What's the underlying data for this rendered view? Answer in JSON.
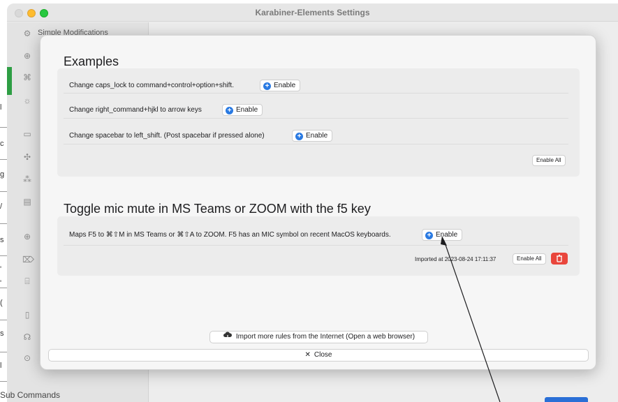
{
  "window": {
    "title": "Karabiner-Elements Settings"
  },
  "sidebar": {
    "visible_label": "Simple Modifications",
    "icons": [
      "gear-icon",
      "circle-arrow-icon",
      "keys-icon",
      "sun-icon",
      "keyboard-icon",
      "gamepad-icon",
      "devices-icon",
      "card-icon",
      "globe-icon",
      "pointer-icon",
      "trash-icon",
      "document-icon",
      "bug-icon",
      "info-icon"
    ]
  },
  "background": {
    "left_fragments": [
      "l",
      "c",
      "g",
      "/",
      "s",
      "'",
      "'",
      "(",
      "s",
      "l"
    ],
    "bottom_fragment": "Sub Commands"
  },
  "sheet": {
    "examples": {
      "title": "Examples",
      "rules": [
        {
          "text": "Change caps_lock to command+control+option+shift.",
          "button": "Enable"
        },
        {
          "text": "Change right_command+hjkl to arrow keys",
          "button": "Enable"
        },
        {
          "text": "Change spacebar to left_shift. (Post spacebar if pressed alone)",
          "button": "Enable"
        }
      ],
      "enable_all": "Enable All"
    },
    "toggle": {
      "title": "Toggle mic mute in MS Teams or ZOOM with the f5 key",
      "rules": [
        {
          "text": "Maps F5 to ⌘⇧M in MS Teams or ⌘⇧A to ZOOM. F5 has an MIC symbol on recent MacOS keyboards.",
          "button": "Enable"
        }
      ],
      "imported": "Imported at 2023-08-24 17:11:37",
      "enable_all": "Enable All"
    },
    "import_button": "Import more rules from the Internet (Open a web browser)",
    "close_button": "Close"
  },
  "colors": {
    "accent_blue": "#2a7ae2",
    "delete_red": "#e9463c",
    "selected_green": "#2e9e44"
  }
}
